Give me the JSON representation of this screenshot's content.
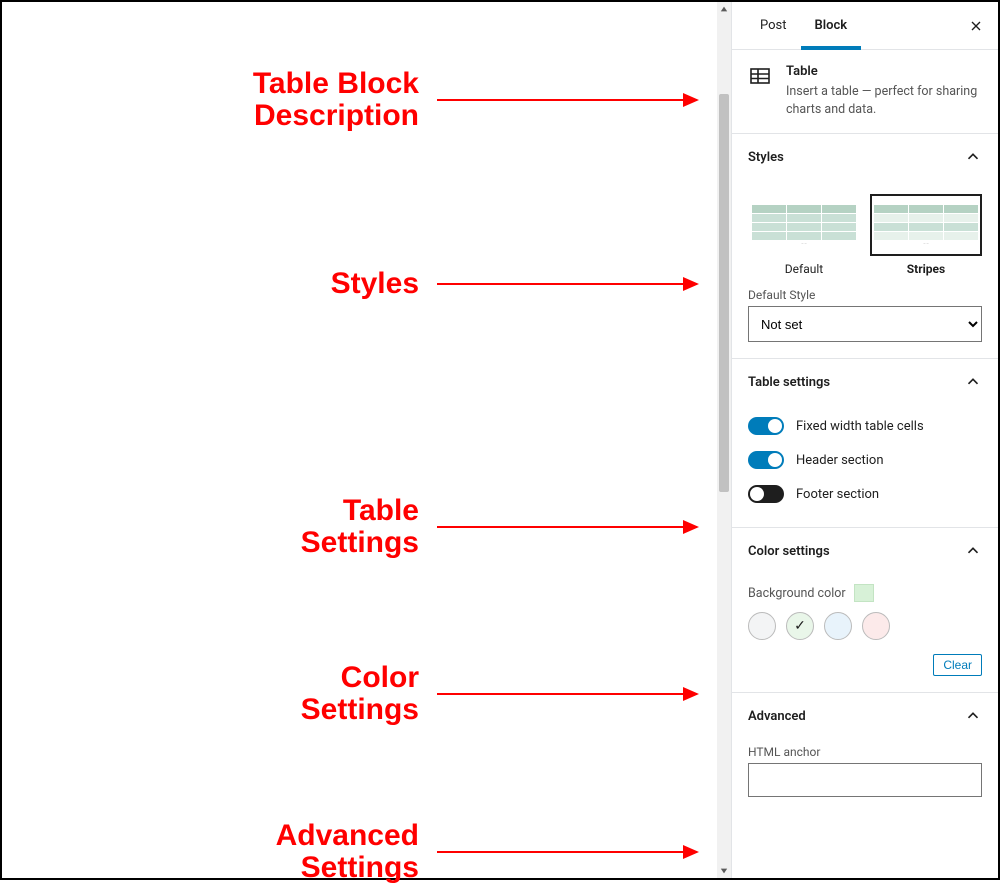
{
  "annotations": {
    "block_desc": "Table Block\nDescription",
    "styles": "Styles",
    "table_settings": "Table\nSettings",
    "color_settings": "Color\nSettings",
    "advanced_settings": "Advanced\nSettings"
  },
  "sidebar": {
    "tab_post": "Post",
    "tab_block": "Block",
    "block_title": "Table",
    "block_description": "Insert a table — perfect for sharing charts and data."
  },
  "styles_panel": {
    "title": "Styles",
    "option_default": "Default",
    "option_stripes": "Stripes",
    "default_style_label": "Default Style",
    "default_style_value": "Not set"
  },
  "table_settings_panel": {
    "title": "Table settings",
    "fixed_width": "Fixed width table cells",
    "header_section": "Header section",
    "footer_section": "Footer section"
  },
  "color_panel": {
    "title": "Color settings",
    "bg_label": "Background color",
    "clear": "Clear"
  },
  "advanced_panel": {
    "title": "Advanced",
    "anchor_label": "HTML anchor"
  }
}
